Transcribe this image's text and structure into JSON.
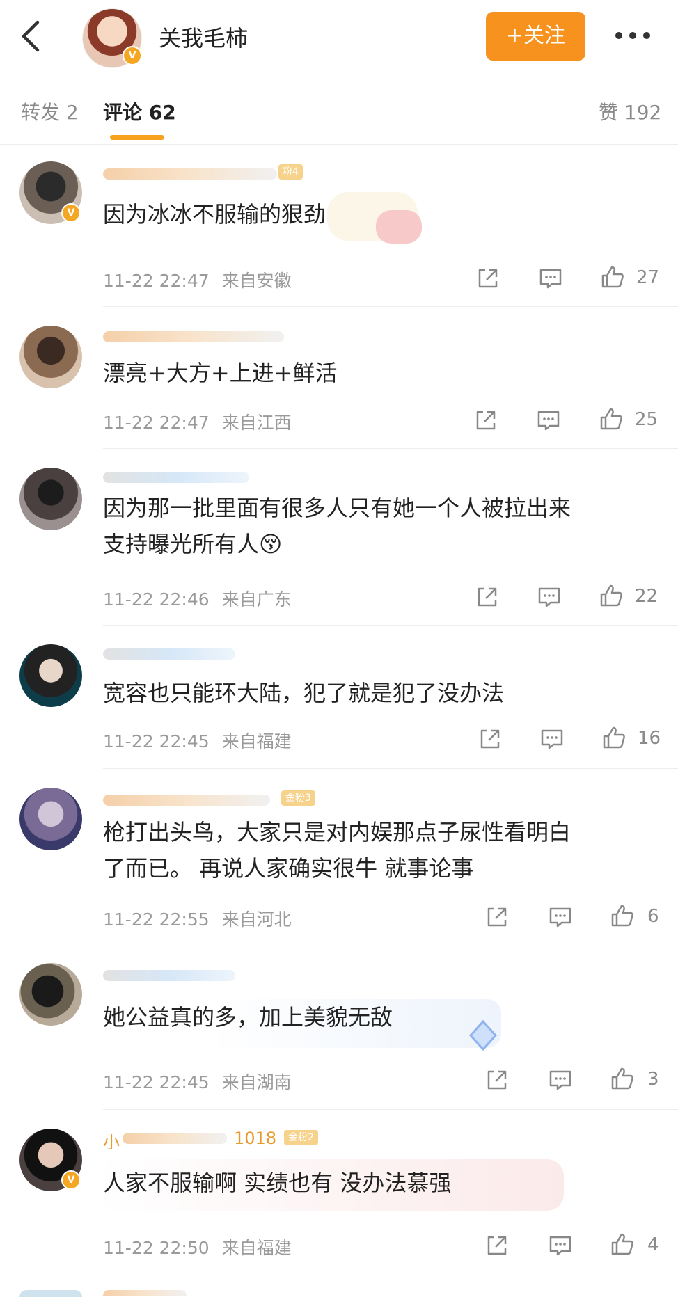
{
  "header": {
    "back_icon": "chevron-left-icon",
    "username": "关我毛柿",
    "follow_label": "+关注",
    "more_icon": "more-dots-icon",
    "verified_icon": "v-badge-icon"
  },
  "tabs": {
    "repost": "转发 2",
    "comments": "评论 62",
    "likes": "赞 192"
  },
  "colors": {
    "accent": "#f7921e",
    "underline": "#f7a11e",
    "meta": "#9a9a9a"
  },
  "comments": [
    {
      "badge": "粉4",
      "text": "因为冰冰不服输的狠劲",
      "text2": "",
      "time": "11-22 22:47",
      "location": "来自安徽",
      "likes": "27"
    },
    {
      "badge": "",
      "text": "漂亮+大方+上进+鲜活",
      "text2": "",
      "time": "11-22 22:47",
      "location": "来自江西",
      "likes": "25"
    },
    {
      "badge": "",
      "text": "因为那一批里面有很多人只有她一个人被拉出来",
      "text2": "支持曝光所有人😚",
      "time": "11-22 22:46",
      "location": "来自广东",
      "likes": "22"
    },
    {
      "badge": "",
      "text": "宽容也只能环大陆，犯了就是犯了没办法",
      "text2": "",
      "time": "11-22 22:45",
      "location": "来自福建",
      "likes": "16"
    },
    {
      "badge": "金粉3",
      "text": "枪打出头鸟，大家只是对内娱那点子尿性看明白",
      "text2": "了而已。 再说人家确实很牛 就事论事",
      "time": "11-22 22:55",
      "location": "来自河北",
      "likes": "6"
    },
    {
      "badge": "",
      "text": "她公益真的多，加上美貌无敌",
      "text2": "",
      "time": "11-22 22:45",
      "location": "来自湖南",
      "likes": "3"
    },
    {
      "badge": "金粉2",
      "name_partial": "小",
      "name_suffix": "1018",
      "text": "人家不服输啊 实绩也有 没办法慕强",
      "text2": "",
      "time": "11-22 22:50",
      "location": "来自福建",
      "likes": "4"
    }
  ],
  "icons": {
    "share": "share-icon",
    "reply": "comment-icon",
    "like": "thumbs-up-icon"
  }
}
